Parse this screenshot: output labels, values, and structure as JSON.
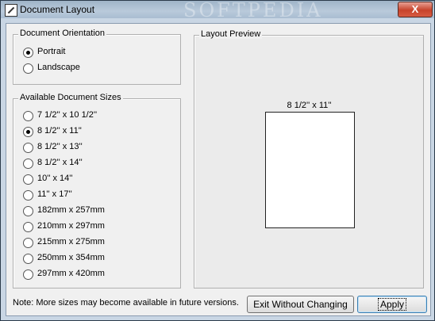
{
  "window": {
    "title": "Document Layout",
    "title_icon": "document-layout-icon",
    "watermark": "SOFTPEDIA",
    "close_glyph": "X"
  },
  "orientation": {
    "legend": "Document Orientation",
    "options": [
      {
        "label": "Portrait",
        "checked": true
      },
      {
        "label": "Landscape",
        "checked": false
      }
    ]
  },
  "sizes": {
    "legend": "Available Document Sizes",
    "options": [
      {
        "label": "7 1/2'' x 10 1/2''",
        "checked": false
      },
      {
        "label": "8 1/2'' x 11''",
        "checked": true
      },
      {
        "label": "8 1/2'' x 13''",
        "checked": false
      },
      {
        "label": "8 1/2'' x 14''",
        "checked": false
      },
      {
        "label": "10'' x 14''",
        "checked": false
      },
      {
        "label": "11'' x 17''",
        "checked": false
      },
      {
        "label": "182mm x 257mm",
        "checked": false
      },
      {
        "label": "210mm x 297mm",
        "checked": false
      },
      {
        "label": "215mm x 275mm",
        "checked": false
      },
      {
        "label": "250mm x 354mm",
        "checked": false
      },
      {
        "label": "297mm x 420mm",
        "checked": false
      }
    ]
  },
  "preview": {
    "legend": "Layout Preview",
    "paper_label": "8 1/2'' x 11''"
  },
  "footer": {
    "note": "Note: More sizes may become available in future versions.",
    "exit_label": "Exit Without Changing",
    "apply_label": "Apply"
  }
}
